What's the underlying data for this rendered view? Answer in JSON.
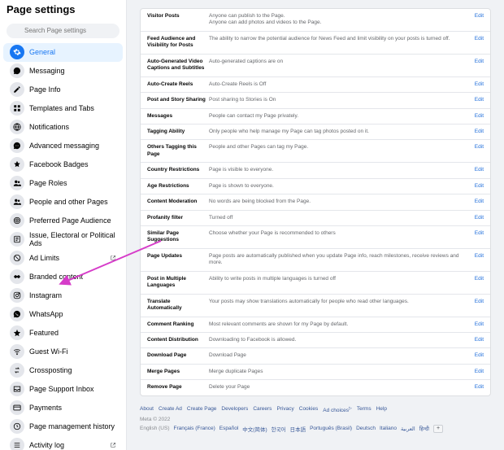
{
  "page_title": "Page settings",
  "search": {
    "placeholder": "Search Page settings"
  },
  "sidebar": {
    "items": [
      {
        "label": "General",
        "icon": "gear-icon",
        "active": true
      },
      {
        "label": "Messaging",
        "icon": "chat-icon"
      },
      {
        "label": "Page Info",
        "icon": "pencil-icon"
      },
      {
        "label": "Templates and Tabs",
        "icon": "grid-icon"
      },
      {
        "label": "Notifications",
        "icon": "globe-icon"
      },
      {
        "label": "Advanced messaging",
        "icon": "chat-dots-icon"
      },
      {
        "label": "Facebook Badges",
        "icon": "badge-icon"
      },
      {
        "label": "Page Roles",
        "icon": "people-icon"
      },
      {
        "label": "People and other Pages",
        "icon": "people-icon"
      },
      {
        "label": "Preferred Page Audience",
        "icon": "target-icon"
      },
      {
        "label": "Issue, Electoral or Political Ads",
        "icon": "ballot-icon"
      },
      {
        "label": "Ad Limits",
        "icon": "limit-icon",
        "external": true
      },
      {
        "label": "Branded content",
        "icon": "handshake-icon"
      },
      {
        "label": "Instagram",
        "icon": "instagram-icon"
      },
      {
        "label": "WhatsApp",
        "icon": "whatsapp-icon"
      },
      {
        "label": "Featured",
        "icon": "star-icon"
      },
      {
        "label": "Guest Wi-Fi",
        "icon": "wifi-icon"
      },
      {
        "label": "Crossposting",
        "icon": "crosspost-icon"
      },
      {
        "label": "Page Support Inbox",
        "icon": "inbox-icon"
      },
      {
        "label": "Payments",
        "icon": "card-icon"
      },
      {
        "label": "Page management history",
        "icon": "history-icon"
      },
      {
        "label": "Activity log",
        "icon": "list-icon",
        "external": true
      }
    ]
  },
  "settings": [
    {
      "label": "Visitor Posts",
      "desc": "Anyone can publish to the Page.\nAnyone can add photos and videos to the Page.",
      "edit": "Edit"
    },
    {
      "label": "Feed Audience and Visibility for Posts",
      "desc": "The ability to narrow the potential audience for News Feed and limit visibility on your posts is turned off.",
      "edit": "Edit"
    },
    {
      "label": "Auto-Generated Video Captions and Subtitles",
      "desc": "Auto-generated captions are on",
      "edit": "Edit"
    },
    {
      "label": "Auto-Create Reels",
      "desc": "Auto-Create Reels is Off",
      "edit": "Edit"
    },
    {
      "label": "Post and Story Sharing",
      "desc": "Post sharing to Stories is On",
      "edit": "Edit"
    },
    {
      "label": "Messages",
      "desc": "People can contact my Page privately.",
      "edit": "Edit"
    },
    {
      "label": "Tagging Ability",
      "desc": "Only people who help manage my Page can tag photos posted on it.",
      "edit": "Edit"
    },
    {
      "label": "Others Tagging this Page",
      "desc": "People and other Pages can tag my Page.",
      "edit": "Edit"
    },
    {
      "label": "Country Restrictions",
      "desc": "Page is visible to everyone.",
      "edit": "Edit"
    },
    {
      "label": "Age Restrictions",
      "desc": "Page is shown to everyone.",
      "edit": "Edit"
    },
    {
      "label": "Content Moderation",
      "desc": "No words are being blocked from the Page.",
      "edit": "Edit"
    },
    {
      "label": "Profanity filter",
      "desc": "Turned off",
      "edit": "Edit"
    },
    {
      "label": "Similar Page Suggestions",
      "desc": "Choose whether your Page is recommended to others",
      "edit": "Edit"
    },
    {
      "label": "Page Updates",
      "desc": "Page posts are automatically published when you update Page info, reach milestones, receive reviews and more.",
      "edit": "Edit"
    },
    {
      "label": "Post in Multiple Languages",
      "desc": "Ability to write posts in multiple languages is turned off",
      "edit": "Edit"
    },
    {
      "label": "Translate Automatically",
      "desc": "Your posts may show translations automatically for people who read other languages.",
      "edit": "Edit"
    },
    {
      "label": "Comment Ranking",
      "desc": "Most relevant comments are shown for my Page by default.",
      "edit": "Edit"
    },
    {
      "label": "Content Distribution",
      "desc": "Downloading to Facebook is allowed.",
      "edit": "Edit"
    },
    {
      "label": "Download Page",
      "desc": "Download Page",
      "edit": "Edit"
    },
    {
      "label": "Merge Pages",
      "desc": "Merge duplicate Pages",
      "edit": "Edit"
    },
    {
      "label": "Remove Page",
      "desc": "Delete your Page",
      "edit": "Edit"
    }
  ],
  "footer": {
    "links": [
      "About",
      "Create Ad",
      "Create Page",
      "Developers",
      "Careers",
      "Privacy",
      "Cookies",
      "Ad choices",
      "Terms",
      "Help"
    ],
    "meta": "Meta © 2022",
    "langs": [
      "English (US)",
      "Français (France)",
      "Español",
      "中文(简体)",
      "한국어",
      "日本語",
      "Português (Brasil)",
      "Deutsch",
      "Italiano",
      "العربية",
      "हिन्दी"
    ],
    "plus": "+"
  }
}
